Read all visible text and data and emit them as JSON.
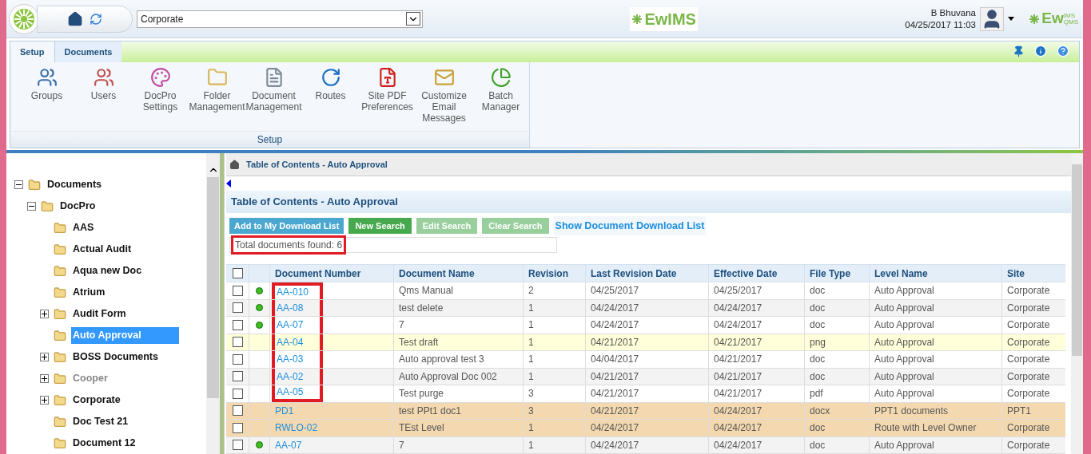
{
  "header": {
    "site_select": {
      "value": "Corporate"
    },
    "brand_center": "EwIMS",
    "user": {
      "name": "B Bhuvana",
      "datetime": "04/25/2017 11:03"
    },
    "brand_right": "Ew",
    "brand_right_sup": "IMS",
    "brand_right_sub": "QMS"
  },
  "ribbon": {
    "tabs": [
      {
        "label": "Setup",
        "selected": true
      },
      {
        "label": "Documents",
        "selected": false
      }
    ],
    "items": [
      {
        "label": "Groups"
      },
      {
        "label": "Users"
      },
      {
        "label": "DocPro Settings"
      },
      {
        "label": "Folder Management"
      },
      {
        "label": "Document Management"
      },
      {
        "label": "Routes"
      },
      {
        "label": "Site PDF Preferences"
      },
      {
        "label": "Customize Email Messages"
      },
      {
        "label": "Batch Manager"
      }
    ],
    "group_label": "Setup"
  },
  "tree": [
    {
      "label": "Documents",
      "expanded": true,
      "selected": false,
      "greyed": false,
      "children": [
        {
          "label": "DocPro",
          "expanded": true,
          "selected": false,
          "greyed": false,
          "children": [
            {
              "label": "AAS",
              "selected": false,
              "greyed": false
            },
            {
              "label": "Actual Audit",
              "selected": false,
              "greyed": false
            },
            {
              "label": "Aqua new Doc",
              "selected": false,
              "greyed": false
            },
            {
              "label": "Atrium",
              "selected": false,
              "greyed": false
            },
            {
              "label": "Audit Form",
              "expanded": false,
              "selected": false,
              "greyed": false
            },
            {
              "label": "Auto Approval",
              "selected": true,
              "greyed": false
            },
            {
              "label": "BOSS Documents",
              "expanded": false,
              "selected": false,
              "greyed": false
            },
            {
              "label": "Cooper",
              "expanded": false,
              "selected": false,
              "greyed": true
            },
            {
              "label": "Corporate",
              "expanded": false,
              "selected": false,
              "greyed": false
            },
            {
              "label": "Doc Test 21",
              "selected": false,
              "greyed": false
            },
            {
              "label": "Document 12",
              "selected": false,
              "greyed": false
            }
          ]
        }
      ]
    }
  ],
  "breadcrumb": "Table of Contents - Auto Approval",
  "panel_title": "Table of Contents - Auto Approval",
  "actions": [
    {
      "label": "Add to My Download List",
      "kind": "primary",
      "disabled": false
    },
    {
      "label": "New Search",
      "kind": "success",
      "disabled": false
    },
    {
      "label": "Edit Search",
      "kind": "success",
      "disabled": true
    },
    {
      "label": "Clear Search",
      "kind": "success",
      "disabled": true
    },
    {
      "label": "Show Document Download List",
      "kind": "link",
      "disabled": false
    }
  ],
  "total_found": {
    "text": "Total documents found: 6",
    "marked": true
  },
  "table": {
    "all_checked": false,
    "columns": [
      "Document Number",
      "Document Name",
      "Revision",
      "Last Revision Date",
      "Effective Date",
      "File Type",
      "Level Name",
      "Site"
    ],
    "rows": [
      {
        "checked": false,
        "dot": true,
        "kind": "plain",
        "marked": true,
        "cells": [
          "AA-010",
          "Qms Manual",
          "2",
          "04/25/2017",
          "04/25/2017",
          "doc",
          "Auto Approval",
          "Corporate"
        ]
      },
      {
        "checked": false,
        "dot": true,
        "kind": "plain",
        "marked": true,
        "cells": [
          "AA-08",
          "test delete",
          "1",
          "04/24/2017",
          "04/24/2017",
          "doc",
          "Auto Approval",
          "Corporate"
        ]
      },
      {
        "checked": false,
        "dot": true,
        "kind": "plain",
        "marked": true,
        "cells": [
          "AA-07",
          "7",
          "1",
          "04/24/2017",
          "04/24/2017",
          "doc",
          "Auto Approval",
          "Corporate"
        ]
      },
      {
        "checked": false,
        "dot": false,
        "kind": "draft",
        "marked": true,
        "cells": [
          "AA-04",
          "Test draft",
          "1",
          "04/21/2017",
          "04/21/2017",
          "png",
          "Auto Approval",
          "Corporate"
        ]
      },
      {
        "checked": false,
        "dot": false,
        "kind": "plain",
        "marked": true,
        "cells": [
          "AA-03",
          "Auto approval test 3",
          "1",
          "04/04/2017",
          "04/21/2017",
          "doc",
          "Auto Approval",
          "Corporate"
        ]
      },
      {
        "checked": false,
        "dot": false,
        "kind": "plain",
        "marked": true,
        "cells": [
          "AA-02",
          "Auto Approval Doc 002",
          "1",
          "04/21/2017",
          "04/21/2017",
          "doc",
          "Auto Approval",
          "Corporate"
        ]
      },
      {
        "checked": false,
        "dot": false,
        "kind": "plain",
        "marked": true,
        "cells": [
          "AA-05",
          "Test purge",
          "3",
          "04/21/2017",
          "04/21/2017",
          "pdf",
          "Auto Approval",
          "Corporate"
        ]
      },
      {
        "checked": false,
        "dot": false,
        "kind": "other",
        "marked": false,
        "cells": [
          "PD1",
          "test PPt1 doc1",
          "3",
          "04/21/2017",
          "04/24/2017",
          "docx",
          "PPT1 documents",
          "PPT1"
        ]
      },
      {
        "checked": false,
        "dot": false,
        "kind": "other",
        "marked": false,
        "cells": [
          "RWLO-02",
          "TEst Level",
          "1",
          "04/24/2017",
          "04/24/2017",
          "doc",
          "Route with Level Owner",
          "Corporate"
        ]
      },
      {
        "checked": false,
        "dot": true,
        "kind": "plain",
        "marked": false,
        "cells": [
          "AA-07",
          "7",
          "1",
          "04/24/2017",
          "04/24/2017",
          "doc",
          "Auto Approval",
          "Corporate"
        ]
      }
    ]
  }
}
